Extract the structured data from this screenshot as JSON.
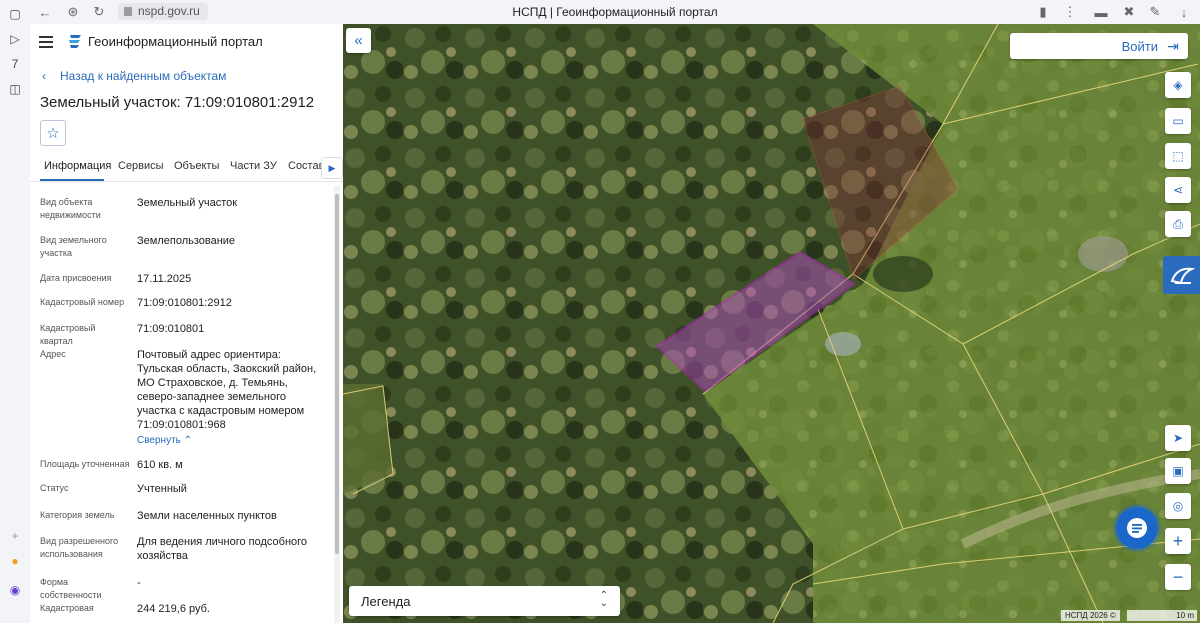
{
  "browser": {
    "tab_title": "НСПД | Геоинформационный портал",
    "url": "nspd.gov.ru"
  },
  "header": {
    "portal_title": "Геоинформационный портал"
  },
  "back_link": "Назад к найденным объектам",
  "object_title": "Земельный участок: 71:09:010801:2912",
  "tabs": [
    "Информация",
    "Сервисы",
    "Объекты",
    "Части ЗУ",
    "Состав"
  ],
  "info": [
    {
      "label": "Вид объекта недвижимости",
      "value": "Земельный участок"
    },
    {
      "label": "Вид земельного участка",
      "value": "Землепользование"
    },
    {
      "label": "Дата присвоения",
      "value": "17.11.2025"
    },
    {
      "label": "Кадастровый номер",
      "value": "71:09:010801:2912"
    },
    {
      "label": "Кадастровый квартал",
      "value": "71:09:010801"
    },
    {
      "label": "Адрес",
      "value": "Почтовый адрес ориентира: Тульская область, Заокский район, МО Страховское, д. Темьянь, северо-западнее земельного участка с кадастровым номером 71:09:010801:968",
      "action": "Свернуть"
    },
    {
      "label": "Площадь уточненная",
      "value": "610 кв. м"
    },
    {
      "label": "Статус",
      "value": "Учтенный"
    },
    {
      "label": "Категория земель",
      "value": "Земли населенных пунктов"
    },
    {
      "label": "Вид разрешенного использования",
      "value": "Для ведения личного подсобного хозяйства"
    },
    {
      "label": "Форма собственности",
      "value": "-"
    },
    {
      "label": "Кадастровая",
      "value": "244 219,6 руб."
    }
  ],
  "map": {
    "login_label": "Войти",
    "legend_label": "Легенда",
    "copyright": "НСПД 2026 ©",
    "scale_label": "10 m",
    "tools": [
      "layers-icon",
      "ruler-icon",
      "select-area-icon",
      "share-icon",
      "print-icon",
      "locate-icon",
      "basemap-icon",
      "geo-search-icon",
      "zoom-in-icon",
      "zoom-out-icon"
    ]
  },
  "colors": {
    "accent": "#2a6bbd",
    "parcel_highlight": "#b04cc0",
    "parcel_boundary": "#e8d77a"
  }
}
